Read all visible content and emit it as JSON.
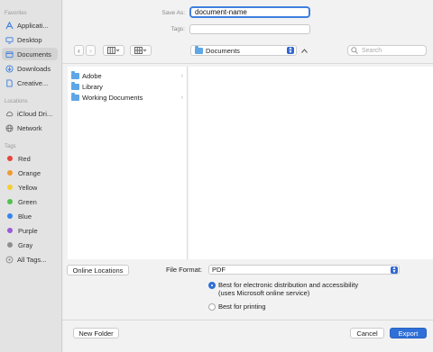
{
  "sidebar": {
    "favorites_heading": "Favorites",
    "favorites": [
      {
        "label": "Applicati...",
        "icon": "applications-icon"
      },
      {
        "label": "Desktop",
        "icon": "desktop-icon"
      },
      {
        "label": "Documents",
        "icon": "documents-icon",
        "selected": true
      },
      {
        "label": "Downloads",
        "icon": "downloads-icon"
      },
      {
        "label": "Creative...",
        "icon": "document-icon"
      }
    ],
    "locations_heading": "Locations",
    "locations": [
      {
        "label": "iCloud Dri...",
        "icon": "cloud-icon"
      },
      {
        "label": "Network",
        "icon": "network-icon"
      }
    ],
    "tags_heading": "Tags",
    "tags": [
      {
        "label": "Red",
        "color": "#e9443c"
      },
      {
        "label": "Orange",
        "color": "#f19a31"
      },
      {
        "label": "Yellow",
        "color": "#f4cf2e"
      },
      {
        "label": "Green",
        "color": "#53c04f"
      },
      {
        "label": "Blue",
        "color": "#3584ee"
      },
      {
        "label": "Purple",
        "color": "#9b5bd7"
      },
      {
        "label": "Gray",
        "color": "#8e8e92"
      }
    ],
    "all_tags": "All Tags..."
  },
  "header": {
    "save_as_label": "Save As:",
    "save_as_value": "document-name",
    "tags_label": "Tags:"
  },
  "toolbar": {
    "back": "‹",
    "forward": "›",
    "location": "Documents",
    "search_placeholder": "Search"
  },
  "files": [
    {
      "name": "Adobe",
      "has_children": true
    },
    {
      "name": "Library",
      "has_children": false
    },
    {
      "name": "Working Documents",
      "has_children": true
    }
  ],
  "options": {
    "online_locations": "Online Locations",
    "file_format_label": "File Format:",
    "file_format_value": "PDF",
    "radio1_line1": "Best for electronic distribution and accessibility",
    "radio1_line2": "(uses Microsoft online service)",
    "radio2": "Best for printing"
  },
  "footer": {
    "new_folder": "New Folder",
    "cancel": "Cancel",
    "export": "Export"
  },
  "colors": {
    "accent": "#2f6fd8",
    "folder": "#5ea6e6"
  }
}
